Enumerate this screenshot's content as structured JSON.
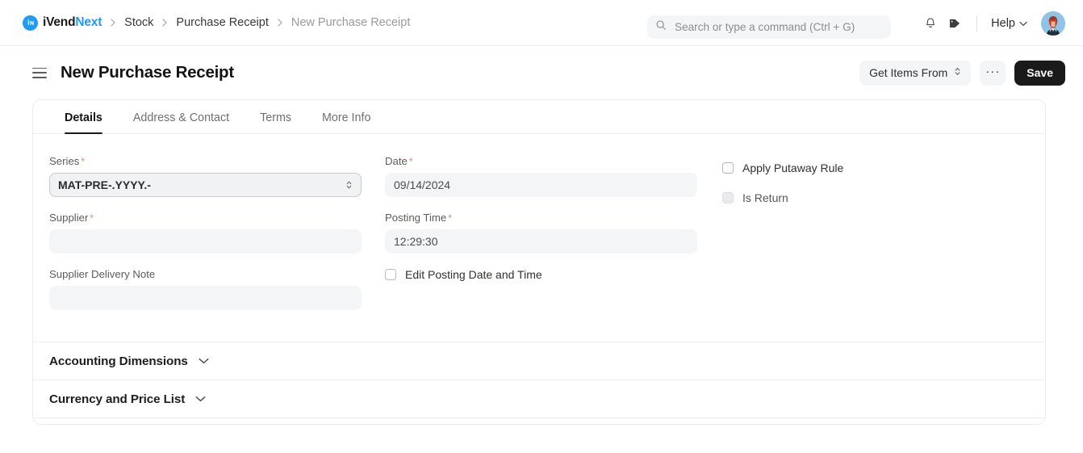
{
  "navbar": {
    "brand": {
      "prefix": "iVend",
      "suffix": "Next",
      "logo_icon": "ivendnext-logo-icon",
      "accent_color": "#1f9cf0"
    },
    "breadcrumbs": [
      {
        "label": "Stock",
        "current": false
      },
      {
        "label": "Purchase Receipt",
        "current": false
      },
      {
        "label": "New Purchase Receipt",
        "current": true
      }
    ],
    "separator": "›",
    "search": {
      "placeholder": "Search or type a command (Ctrl + G)",
      "value": "",
      "icon": "search-icon"
    },
    "notifications_icon": "bell-icon",
    "tag_icon": "tag-icon",
    "help": {
      "label": "Help",
      "icon": "chevron-down-icon"
    },
    "avatar": {
      "name": "user-avatar"
    }
  },
  "header": {
    "menu_icon": "hamburger-menu-icon",
    "title": "New Purchase Receipt",
    "get_items_from": {
      "label": "Get Items From",
      "icon": "chevron-updown-icon"
    },
    "more_label": "···",
    "save_label": "Save"
  },
  "tabs": [
    {
      "label": "Details",
      "active": true
    },
    {
      "label": "Address & Contact",
      "active": false
    },
    {
      "label": "Terms",
      "active": false
    },
    {
      "label": "More Info",
      "active": false
    }
  ],
  "form": {
    "series": {
      "label": "Series",
      "required": true,
      "value": "MAT-PRE-.YYYY.-"
    },
    "supplier": {
      "label": "Supplier",
      "required": true,
      "value": ""
    },
    "supplier_delivery_note": {
      "label": "Supplier Delivery Note",
      "required": false,
      "value": ""
    },
    "date": {
      "label": "Date",
      "required": true,
      "value": "09/14/2024"
    },
    "posting_time": {
      "label": "Posting Time",
      "required": true,
      "value": "12:29:30"
    },
    "edit_posting": {
      "label": "Edit Posting Date and Time",
      "checked": false
    },
    "apply_putaway_rule": {
      "label": "Apply Putaway Rule",
      "checked": false
    },
    "is_return": {
      "label": "Is Return",
      "checked": false,
      "disabled": true
    },
    "required_marker": "*"
  },
  "sections": [
    {
      "label": "Accounting Dimensions",
      "icon": "chevron-down-icon",
      "expanded": false
    },
    {
      "label": "Currency and Price List",
      "icon": "chevron-down-icon",
      "expanded": false
    }
  ]
}
